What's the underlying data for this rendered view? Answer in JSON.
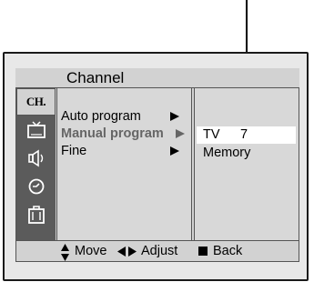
{
  "menu": {
    "title": "Channel",
    "icons": [
      {
        "name": "ch-icon",
        "text": "CH.",
        "active": true
      },
      {
        "name": "picture-icon",
        "active": false
      },
      {
        "name": "sound-icon",
        "active": false
      },
      {
        "name": "timer-icon",
        "active": false
      },
      {
        "name": "setup-icon",
        "active": false
      }
    ],
    "items": [
      {
        "label": "Auto program",
        "selected": false
      },
      {
        "label": "Manual program",
        "selected": true
      },
      {
        "label": "Fine",
        "selected": false
      }
    ],
    "submenu": {
      "tv_label": "TV",
      "tv_number": "7",
      "memory_label": "Memory"
    }
  },
  "footer": {
    "move_label": "Move",
    "adjust_label": "Adjust",
    "back_label": "Back"
  },
  "colors": {
    "panel_bg": "#d2d2d2",
    "icon_column_bg": "#5b5b5b",
    "selected_text": "#666666",
    "highlight_bg": "#ffffff"
  }
}
